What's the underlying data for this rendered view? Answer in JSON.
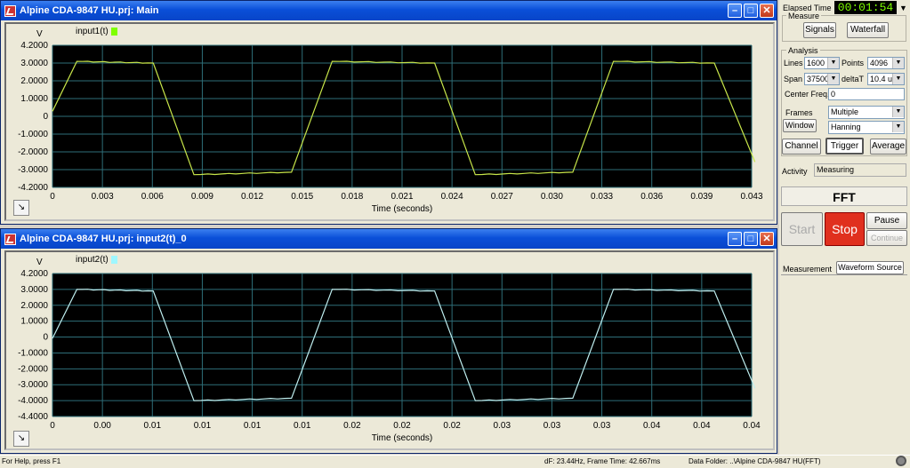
{
  "windows": [
    {
      "title": "Alpine CDA-9847 HU.prj: Main",
      "y_unit": "V",
      "signal": "input1(t)",
      "color": "#c8e64a",
      "swatch": "#7fff00",
      "yticks": [
        "4.2000",
        "3.0000",
        "2.0000",
        "1.0000",
        "0",
        "-1.0000",
        "-2.0000",
        "-3.0000",
        "-4.2000"
      ],
      "xticks": [
        "0",
        "0.003",
        "0.006",
        "0.009",
        "0.012",
        "0.015",
        "0.018",
        "0.021",
        "0.024",
        "0.027",
        "0.030",
        "0.033",
        "0.036",
        "0.039",
        "0.043"
      ],
      "xlabel": "Time (seconds)"
    },
    {
      "title": "Alpine CDA-9847 HU.prj: input2(t)_0",
      "y_unit": "V",
      "signal": "input2(t)",
      "color": "#bfeff0",
      "swatch": "#9ff7ff",
      "yticks": [
        "4.2000",
        "3.0000",
        "2.0000",
        "1.0000",
        "0",
        "-1.0000",
        "-2.0000",
        "-3.0000",
        "-4.0000",
        "-4.4000"
      ],
      "xticks": [
        "0",
        "0.00",
        "0.01",
        "0.01",
        "0.01",
        "0.01",
        "0.02",
        "0.02",
        "0.02",
        "0.03",
        "0.03",
        "0.03",
        "0.04",
        "0.04",
        "0.04"
      ],
      "xlabel": "Time (seconds)"
    }
  ],
  "chart_data": [
    {
      "type": "line",
      "title": "",
      "series": [
        {
          "name": "input1(t)",
          "x": [
            0,
            0.0015,
            0.0062,
            0.0087,
            0.0147,
            0.0172,
            0.0235,
            0.026,
            0.032,
            0.0345,
            0.0407,
            0.0432
          ],
          "y": [
            0.3,
            3.25,
            3.15,
            -3.45,
            -3.3,
            3.25,
            3.15,
            -3.45,
            -3.3,
            3.25,
            3.15,
            -2.7
          ]
        }
      ],
      "xlabel": "Time (seconds)",
      "ylabel": "V",
      "xlim": [
        0,
        0.043
      ],
      "ylim": [
        -4.2,
        4.2
      ],
      "grid": true
    },
    {
      "type": "line",
      "title": "",
      "series": [
        {
          "name": "input2(t)",
          "x": [
            0,
            0.0015,
            0.0062,
            0.0087,
            0.0147,
            0.0172,
            0.0235,
            0.026,
            0.032,
            0.0345,
            0.0407,
            0.0432
          ],
          "y": [
            0.3,
            3.25,
            3.15,
            -3.45,
            -3.3,
            3.25,
            3.15,
            -3.45,
            -3.3,
            3.25,
            3.15,
            -2.7
          ]
        }
      ],
      "xlabel": "Time (seconds)",
      "ylabel": "V",
      "xlim": [
        0,
        0.043
      ],
      "ylim": [
        -4.4,
        4.2
      ],
      "grid": true
    }
  ],
  "panel": {
    "elapsed_label": "Elapsed Time",
    "elapsed_value": "00:01:54",
    "measure_label": "Measure",
    "signals": "Signals",
    "waterfall": "Waterfall",
    "analysis_label": "Analysis",
    "lines_label": "Lines",
    "lines_value": "1600",
    "points_label": "Points",
    "points_value": "4096",
    "span_label": "Span",
    "span_value": "37500",
    "deltat_label": "deltaT",
    "deltat_value": "10.4 u",
    "center_label": "Center Freq.",
    "center_value": "0",
    "frames_label": "Frames",
    "frames_value": "Multiple",
    "window_label": "Window",
    "window_value": "Hanning",
    "channel": "Channel",
    "trigger": "Trigger",
    "average": "Average",
    "activity_label": "Activity",
    "activity_value": "Measuring",
    "fft": "FFT",
    "start": "Start",
    "stop": "Stop",
    "pause": "Pause",
    "continue": "Continue",
    "tab_measurement": "Measurement",
    "tab_waveform": "Waveform Source"
  },
  "status": {
    "help": "For Help, press F1",
    "df": "dF: 23.44Hz, Frame Time: 42.667ms",
    "folder": "Data Folder: ..\\Alpine CDA-9847 HU(FFT)"
  }
}
